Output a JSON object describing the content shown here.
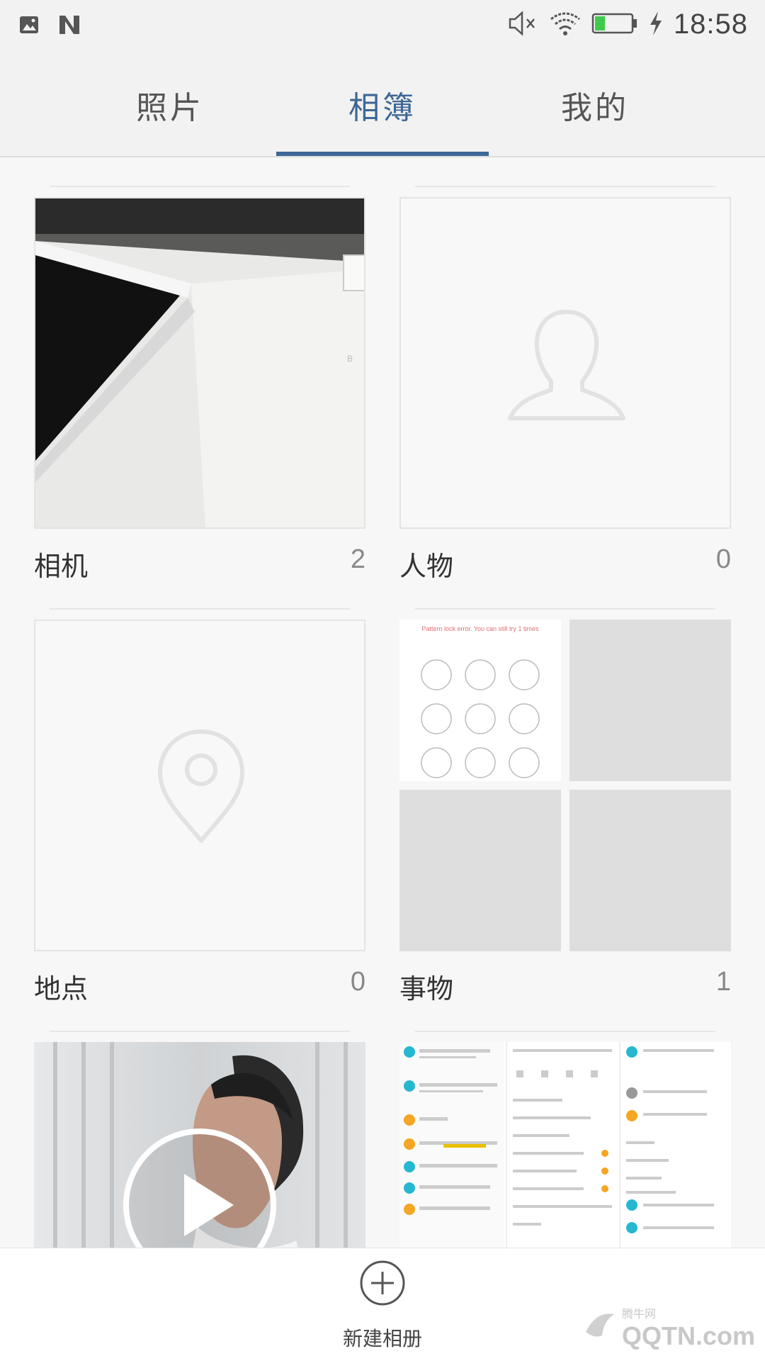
{
  "status_bar": {
    "time": "18:58",
    "left_icons": [
      "image-icon",
      "n-icon"
    ],
    "right_icons": [
      "mute-icon",
      "wifi-icon",
      "battery-icon",
      "charging-icon"
    ]
  },
  "tabs": [
    {
      "label": "照片",
      "active": false
    },
    {
      "label": "相簿",
      "active": true
    },
    {
      "label": "我的",
      "active": false
    }
  ],
  "albums": [
    {
      "label": "相机",
      "count": "2",
      "thumb": "photo"
    },
    {
      "label": "人物",
      "count": "0",
      "thumb": "person-placeholder-icon"
    },
    {
      "label": "地点",
      "count": "0",
      "thumb": "location-pin-icon"
    },
    {
      "label": "事物",
      "count": "1",
      "thumb": "collage"
    },
    {
      "label": "",
      "count": "",
      "thumb": "video"
    },
    {
      "label": "",
      "count": "",
      "thumb": "screenshots"
    }
  ],
  "pattern_lock_error": "Pattern lock error. You can still try 1 times",
  "bottom_bar": {
    "new_album_label": "新建相册"
  },
  "watermark": {
    "text": "QQTN.com",
    "small": "腾牛网"
  },
  "colors": {
    "accent": "#3d6796",
    "background": "#f7f7f7"
  }
}
